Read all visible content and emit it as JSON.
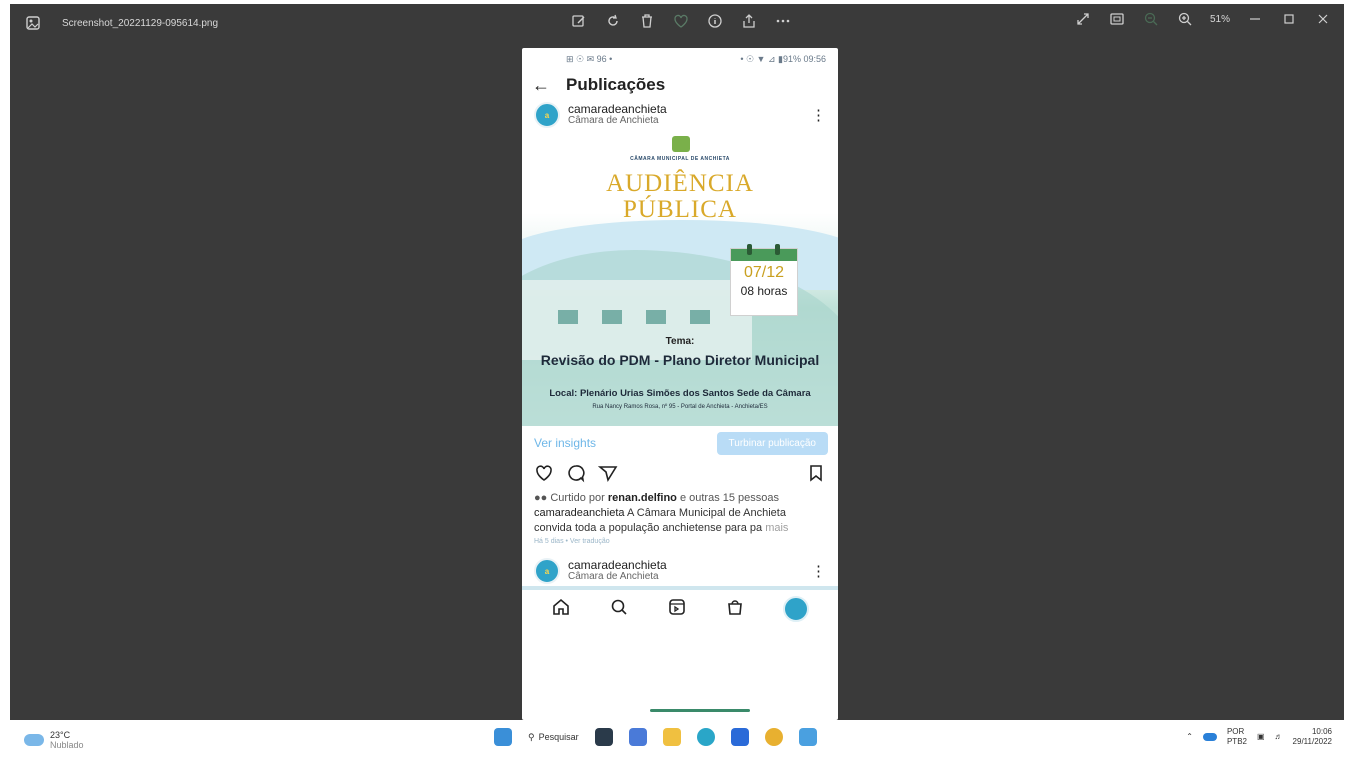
{
  "viewer": {
    "filename": "Screenshot_20221129-095614.png",
    "zoom": "51%"
  },
  "phone": {
    "status_left": "⊞ ☉ ✉ 96 •",
    "status_right": "• ☉ ▼ ⊿ ▮91% 09:56",
    "header_title": "Publicações",
    "post": {
      "username": "camaradeanchieta",
      "subtitle": "Câmara de Anchieta",
      "poster": {
        "org": "CÂMARA MUNICIPAL DE ANCHIETA",
        "title_line1": "AUDIÊNCIA",
        "title_line2": "PÚBLICA",
        "date": "07/12",
        "time": "08 horas",
        "tema_label": "Tema:",
        "tema": "Revisão do PDM - Plano Diretor Municipal",
        "local": "Local: Plenário Urias Simões dos Santos Sede da Câmara",
        "address": "Rua Nancy Ramos Rosa, nº 95 - Portal de Anchieta - Anchieta/ES"
      },
      "insights_link": "Ver insights",
      "boost_button": "Turbinar publicação",
      "likes_prefix": "Curtido por ",
      "likes_user": "renan.delfino",
      "likes_suffix": " e outras 15 pessoas",
      "caption_user": "camaradeanchieta",
      "caption_text": " A Câmara Municipal de Anchieta convida toda a população anchietense para pa",
      "more": "mais",
      "meta": "Há 5 dias • Ver tradução"
    },
    "next_post": {
      "username": "camaradeanchieta",
      "subtitle": "Câmara de Anchieta"
    }
  },
  "taskbar": {
    "temp": "23°C",
    "condition": "Nublado",
    "search_label": "Pesquisar",
    "lang1": "POR",
    "lang2": "PTB2",
    "time": "10:06",
    "date": "29/11/2022"
  },
  "colors": {
    "viewer_bg": "#3a3a3a",
    "gold": "#d9a92a",
    "link_blue": "#6fb7e8",
    "calendar_green": "#4a9a5a"
  }
}
